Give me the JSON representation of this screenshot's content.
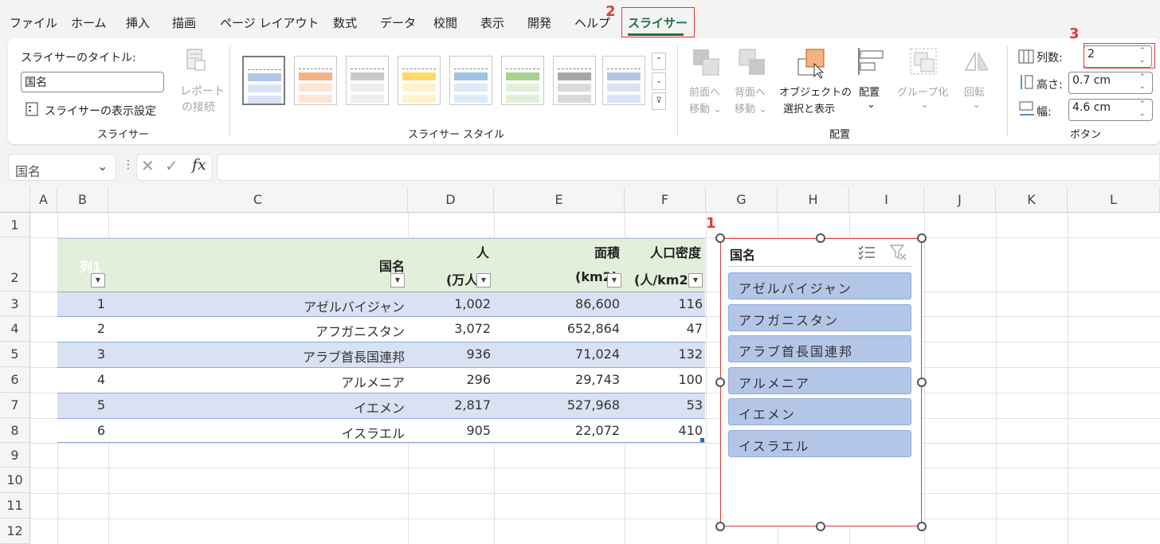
{
  "menu": {
    "items": [
      "ファイル",
      "ホーム",
      "挿入",
      "描画",
      "ページ レイアウト",
      "数式",
      "データ",
      "校閲",
      "表示",
      "開発",
      "ヘルプ",
      "スライサー"
    ],
    "active": "スライサー"
  },
  "annotations": {
    "n1": "1",
    "n2": "2",
    "n3": "3"
  },
  "ribbon": {
    "slicer_group": {
      "caption_label": "スライサーのタイトル:",
      "caption_value": "国名",
      "settings_label": "スライサーの表示設定",
      "report_connections_1": "レポート",
      "report_connections_2": "の接続",
      "group_label": "スライサー"
    },
    "styles_group": {
      "group_label": "スライサー スタイル"
    },
    "arrange_group": {
      "bring_forward_1": "前面へ",
      "bring_forward_2": "移動 ⌄",
      "send_backward_1": "背面へ",
      "send_backward_2": "移動 ⌄",
      "selection_pane_1": "オブジェクトの",
      "selection_pane_2": "選択と表示",
      "align": "配置",
      "group": "グループ化",
      "rotate": "回転",
      "group_label": "配置"
    },
    "buttons_group": {
      "columns_label": "列数:",
      "columns_value": "2",
      "height_label": "高さ:",
      "height_value": "0.7 cm",
      "width_label": "幅:",
      "width_value": "4.6 cm",
      "group_label": "ボタン"
    }
  },
  "formula_bar": {
    "name_box": "国名",
    "fx": "fx"
  },
  "columns": [
    "A",
    "B",
    "C",
    "D",
    "E",
    "F",
    "G",
    "H",
    "I",
    "J",
    "K",
    "L"
  ],
  "rows": [
    "1",
    "2",
    "3",
    "4",
    "5",
    "6",
    "7",
    "8",
    "9",
    "10",
    "11",
    "12"
  ],
  "table": {
    "headers": {
      "col1": "列1",
      "country": "国名",
      "pop_1": "人",
      "pop_2": "(万人)",
      "area_1": "面積",
      "area_2": "(km2)",
      "density_1": "人口密度",
      "density_2": "(人/km2)"
    },
    "rows": [
      {
        "no": "1",
        "country": "アゼルバイジャン",
        "pop": "1,002",
        "area": "86,600",
        "density": "116"
      },
      {
        "no": "2",
        "country": "アフガニスタン",
        "pop": "3,072",
        "area": "652,864",
        "density": "47"
      },
      {
        "no": "3",
        "country": "アラブ首長国連邦",
        "pop": "936",
        "area": "71,024",
        "density": "132"
      },
      {
        "no": "4",
        "country": "アルメニア",
        "pop": "296",
        "area": "29,743",
        "density": "100"
      },
      {
        "no": "5",
        "country": "イエメン",
        "pop": "2,817",
        "area": "527,968",
        "density": "53"
      },
      {
        "no": "6",
        "country": "イスラエル",
        "pop": "905",
        "area": "22,072",
        "density": "410"
      }
    ]
  },
  "slicer": {
    "title": "国名",
    "items": [
      "アゼルバイジャン",
      "アフガニスタン",
      "アラブ首長国連邦",
      "アルメニア",
      "イエメン",
      "イスラエル"
    ]
  }
}
